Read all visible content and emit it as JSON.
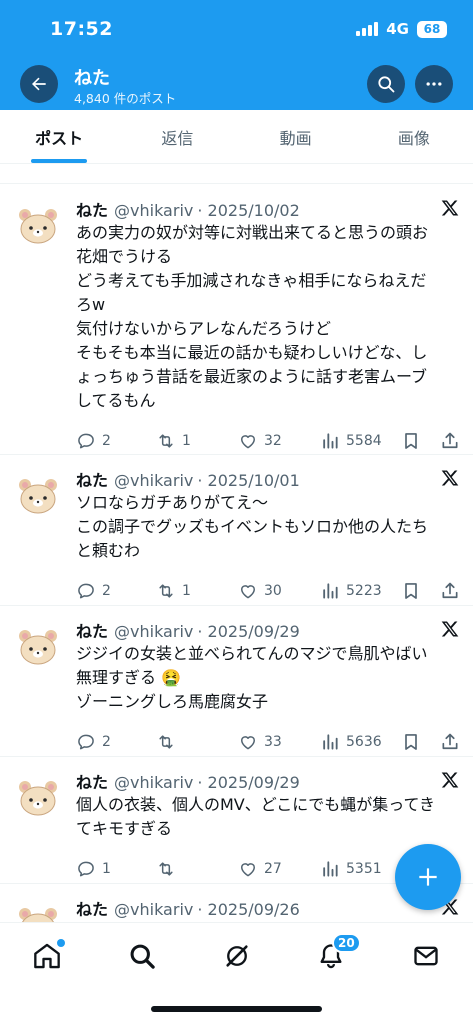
{
  "status": {
    "time": "17:52",
    "network": "4G",
    "battery": "68"
  },
  "header": {
    "title": "ねた",
    "post_count": "4,840 件のポスト"
  },
  "tabs": [
    {
      "label": "ポスト",
      "active": true
    },
    {
      "label": "返信",
      "active": false
    },
    {
      "label": "動画",
      "active": false
    },
    {
      "label": "画像",
      "active": false
    }
  ],
  "posts": [
    {
      "name": "ねた",
      "handle": "@vhikariv",
      "date": "· 2025/10/02",
      "lines": [
        "あの実力の奴が対等に対戦出来てると思うの頭お",
        "花畑でうける",
        "どう考えても手加減されなきゃ相手にならねえだ",
        "ろw",
        "気付けないからアレなんだろうけど",
        "そもそも本当に最近の話かも疑わしいけどな、し",
        "ょっちゅう昔話を最近家のように話す老害ムーブ",
        "してるもん"
      ],
      "replies": "2",
      "reposts": "1",
      "likes": "32",
      "views": "5584"
    },
    {
      "name": "ねた",
      "handle": "@vhikariv",
      "date": "· 2025/10/01",
      "lines": [
        "ソロならガチありがてえ～",
        "この調子でグッズもイベントもソロか他の人たち",
        "と頼むわ"
      ],
      "replies": "2",
      "reposts": "1",
      "likes": "30",
      "views": "5223"
    },
    {
      "name": "ねた",
      "handle": "@vhikariv",
      "date": "· 2025/09/29",
      "lines": [
        "ジジイの女装と並べられてんのマジで鳥肌やばい",
        "無理すぎる 🤮",
        "ゾーニングしろ馬鹿腐女子"
      ],
      "replies": "2",
      "reposts": "",
      "likes": "33",
      "views": "5636"
    },
    {
      "name": "ねた",
      "handle": "@vhikariv",
      "date": "· 2025/09/29",
      "lines": [
        "個人の衣装、個人のMV、どこにでも蝿が集ってき",
        "てキモすぎる"
      ],
      "replies": "1",
      "reposts": "",
      "likes": "27",
      "views": "5351"
    },
    {
      "name": "ねた",
      "handle": "@vhikariv",
      "date": "· 2025/09/26",
      "lines": [],
      "replies": "",
      "reposts": "",
      "likes": "",
      "views": ""
    }
  ],
  "bottom_nav": {
    "notifications_count": "20"
  },
  "colors": {
    "accent": "#1d9bf0",
    "text": "#0f1419",
    "muted": "#536471"
  }
}
